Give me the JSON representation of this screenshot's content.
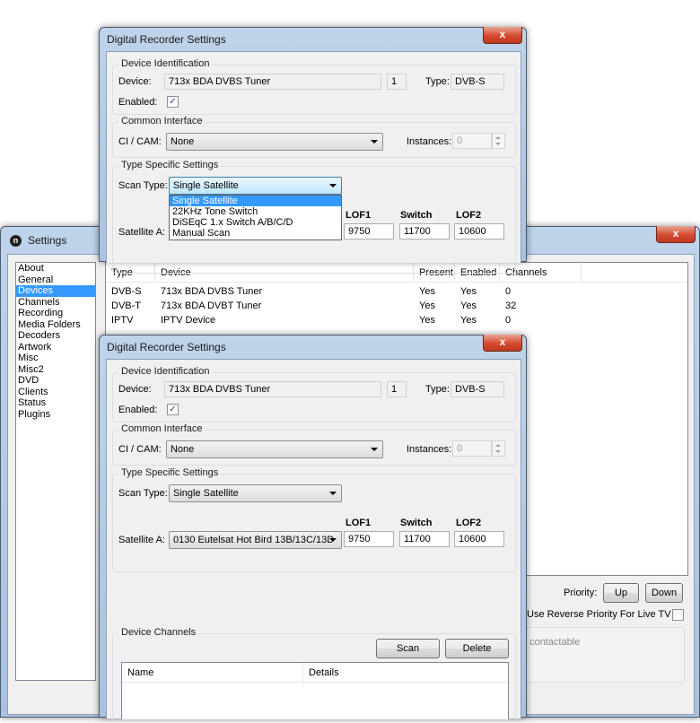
{
  "dialog_top": {
    "title": "Digital Recorder Settings",
    "close_label": "x",
    "device_identification": {
      "legend": "Device Identification",
      "device_label": "Device:",
      "device_value": "713x BDA DVBS Tuner",
      "index_value": "1",
      "type_label": "Type:",
      "type_value": "DVB-S",
      "enabled_label": "Enabled:",
      "enabled_mark": "✓"
    },
    "common_interface": {
      "legend": "Common Interface",
      "cicam_label": "CI / CAM:",
      "cicam_value": "None",
      "instances_label": "Instances:",
      "instances_value": "0"
    },
    "type_specific": {
      "legend": "Type Specific Settings",
      "scan_type_label": "Scan Type:",
      "scan_type_value": "Single Satellite",
      "scan_type_options": [
        "Single Satellite",
        "22KHz Tone Switch",
        "DiSEqC 1.x Switch A/B/C/D",
        "Manual Scan"
      ],
      "lof1_header": "LOF1",
      "switch_header": "Switch",
      "lof2_header": "LOF2",
      "satellite_label": "Satellite A:",
      "lof1_value": "9750",
      "switch_value": "11700",
      "lof2_value": "10600"
    }
  },
  "settings_window": {
    "title": "Settings",
    "close_label": "x",
    "sidebar": [
      "About",
      "General",
      "Devices",
      "Channels",
      "Recording",
      "Media Folders",
      "Decoders",
      "Artwork",
      "Misc",
      "Misc2",
      "DVD",
      "Clients",
      "Status",
      "Plugins"
    ],
    "sidebar_selected": 2,
    "device_table": {
      "columns": [
        "Type",
        "Device",
        "Present",
        "Enabled",
        "Channels"
      ],
      "rows": [
        [
          "DVB-S",
          "713x BDA DVBS Tuner",
          "Yes",
          "Yes",
          "0"
        ],
        [
          "DVB-T",
          "713x BDA DVBT Tuner",
          "Yes",
          "Yes",
          "32"
        ],
        [
          "IPTV",
          "IPTV Device",
          "Yes",
          "Yes",
          "0"
        ]
      ]
    },
    "priority_label": "Priority:",
    "up_label": "Up",
    "down_label": "Down",
    "reverse_priority_label": "Use Reverse Priority For Live TV",
    "contactable_text": "contactable"
  },
  "dialog_bottom": {
    "title": "Digital Recorder Settings",
    "close_label": "x",
    "device_identification": {
      "legend": "Device Identification",
      "device_label": "Device:",
      "device_value": "713x BDA DVBS Tuner",
      "index_value": "1",
      "type_label": "Type:",
      "type_value": "DVB-S",
      "enabled_label": "Enabled:",
      "enabled_mark": "✓"
    },
    "common_interface": {
      "legend": "Common Interface",
      "cicam_label": "CI / CAM:",
      "cicam_value": "None",
      "instances_label": "Instances:",
      "instances_value": "0"
    },
    "type_specific": {
      "legend": "Type Specific Settings",
      "scan_type_label": "Scan Type:",
      "scan_type_value": "Single Satellite",
      "lof1_header": "LOF1",
      "switch_header": "Switch",
      "lof2_header": "LOF2",
      "satellite_label": "Satellite A:",
      "satellite_value": "0130 Eutelsat Hot Bird 13B/13C/13D",
      "lof1_value": "9750",
      "switch_value": "11700",
      "lof2_value": "10600"
    },
    "device_channels": {
      "legend": "Device Channels",
      "scan_label": "Scan",
      "delete_label": "Delete",
      "columns": [
        "Name",
        "Details"
      ]
    }
  },
  "colors": {
    "selection": "#3399ff",
    "close_button": "#c7432a",
    "frame": "#b2c8e3"
  }
}
